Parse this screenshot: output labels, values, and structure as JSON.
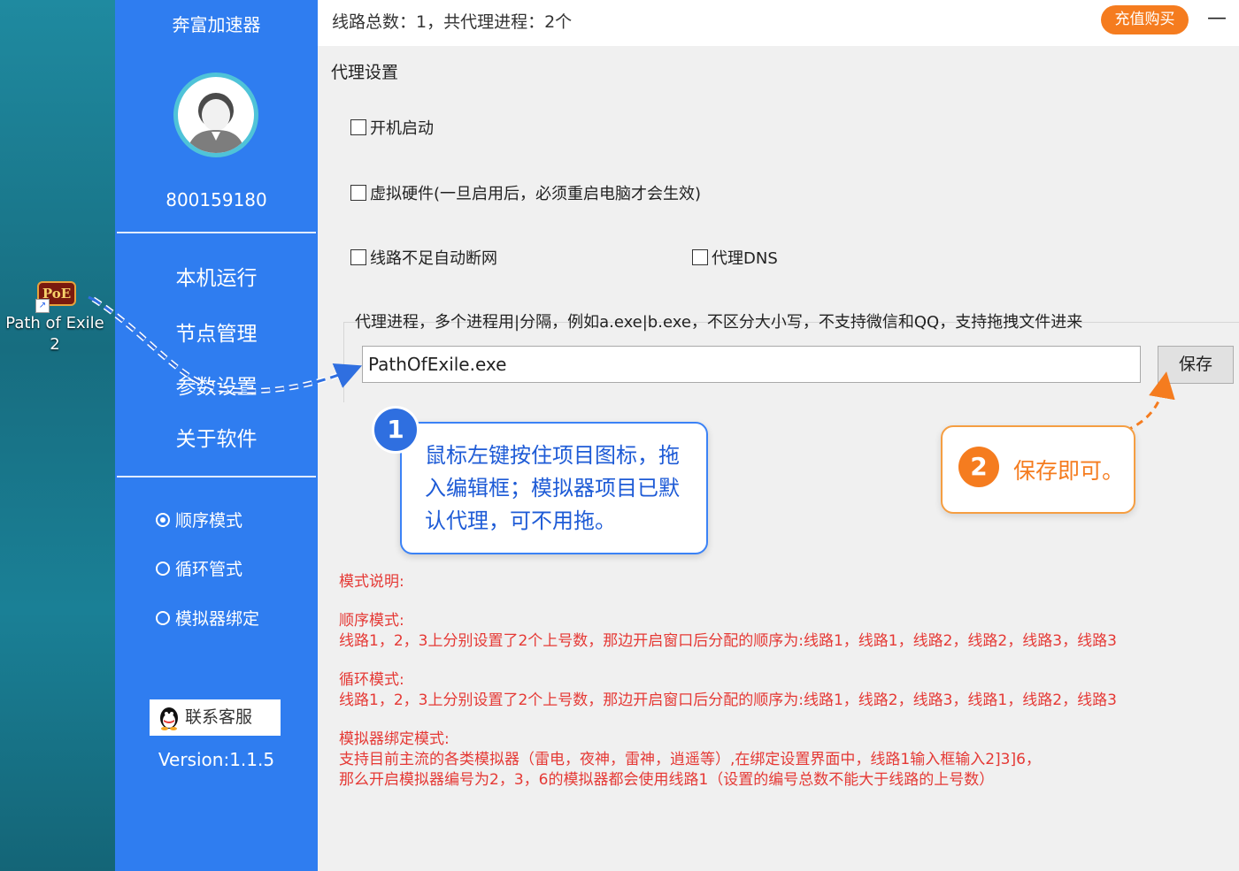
{
  "desktop": {
    "icon_label": "Path of Exile 2",
    "icon_logo_text": "PoE"
  },
  "sidebar": {
    "title": "奔富加速器",
    "user_id": "800159180",
    "nav": [
      "本机运行",
      "节点管理",
      "参数设置",
      "关于软件"
    ],
    "modes": [
      {
        "label": "顺序模式",
        "selected": true
      },
      {
        "label": "循环管式",
        "selected": false
      },
      {
        "label": "模拟器绑定",
        "selected": false
      }
    ],
    "contact_label": "联系客服",
    "version": "Version:1.1.5"
  },
  "topbar": {
    "route_count": "线路总数：1，共代理进程：2个",
    "recharge_label": "充值购买",
    "minimize": "—"
  },
  "settings": {
    "title": "代理设置",
    "checkboxes": {
      "autostart": "开机启动",
      "virtual_hw": "虚拟硬件(一旦启用后，必须重启电脑才会生效)",
      "auto_disconnect": "线路不足自动断网",
      "proxy_dns": "代理DNS"
    },
    "process_label": "代理进程，多个进程用|分隔，例如a.exe|b.exe，不区分大小写，不支持微信和QQ，支持拖拽文件进来",
    "process_value": "PathOfExile.exe",
    "save_label": "保存"
  },
  "callouts": {
    "step1_num": "1",
    "step1_text": "鼠标左键按住项目图标，拖入编辑框；模拟器项目已默认代理，可不用拖。",
    "step2_num": "2",
    "step2_text": "保存即可。"
  },
  "description": {
    "heading": "模式说明:",
    "sequential_title": "顺序模式:",
    "sequential_text": "线路1，2，3上分别设置了2个上号数，那边开启窗口后分配的顺序为:线路1，线路1，线路2，线路2，线路3，线路3",
    "loop_title": "循环模式:",
    "loop_text": "线路1，2，3上分别设置了2个上号数，那边开启窗口后分配的顺序为:线路1，线路2，线路3，线路1，线路2，线路3",
    "emulator_title": "模拟器绑定模式:",
    "emulator_line1": "支持目前主流的各类模拟器（雷电，夜神，雷神，逍遥等）,在绑定设置界面中，线路1输入框输入2]3]6，",
    "emulator_line2": "那么开启模拟器编号为2，3，6的模拟器都会使用线路1（设置的编号总数不能大于线路的上号数）"
  },
  "colors": {
    "sidebar": "#2f7df0",
    "accent_orange": "#f57c1f",
    "description_red": "#e53935",
    "callout_blue": "#1e5bd6"
  }
}
